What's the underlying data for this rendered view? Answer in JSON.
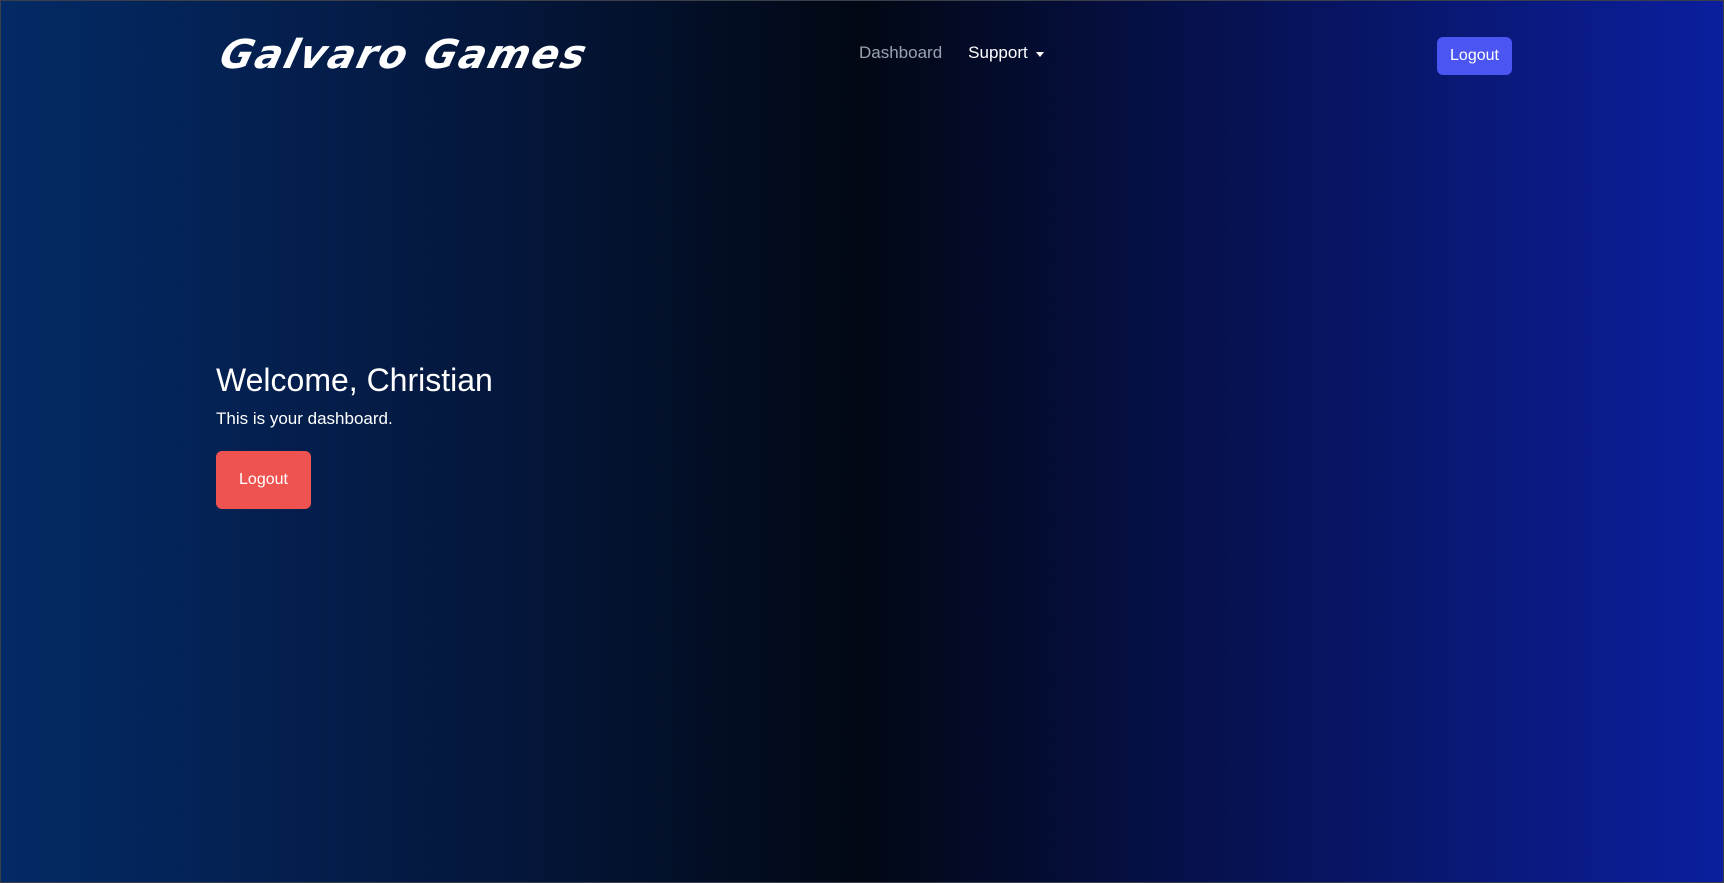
{
  "navbar": {
    "brand": "Galvaro Games",
    "links": {
      "dashboard": "Dashboard",
      "support": "Support"
    },
    "logout_label": "Logout"
  },
  "hero": {
    "title": "Welcome, Christian",
    "subtitle": "This is your dashboard.",
    "logout_label": "Logout"
  },
  "colors": {
    "nav_logout_bg": "#4a55f2",
    "hero_logout_bg": "#ef5350",
    "nav_link_muted": "#9aa3b2"
  },
  "icons": {
    "support_caret": "chevron-down-icon"
  }
}
